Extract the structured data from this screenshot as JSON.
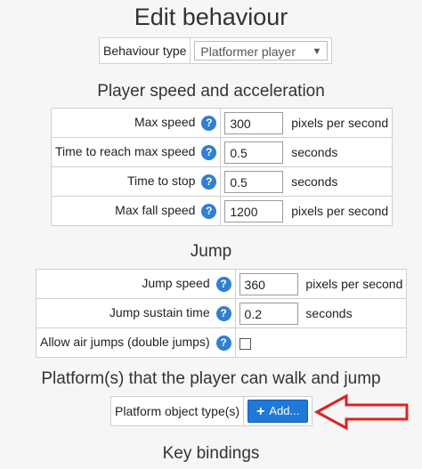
{
  "title": "Edit behaviour",
  "behaviour_type": {
    "label": "Behaviour type",
    "selected": "Platformer player"
  },
  "speed_section": {
    "heading": "Player speed and acceleration",
    "rows": [
      {
        "label": "Max speed",
        "value": "300",
        "unit": "pixels per second"
      },
      {
        "label": "Time to reach max speed",
        "value": "0.5",
        "unit": "seconds"
      },
      {
        "label": "Time to stop",
        "value": "0.5",
        "unit": "seconds"
      },
      {
        "label": "Max fall speed",
        "value": "1200",
        "unit": "pixels per second"
      }
    ]
  },
  "jump_section": {
    "heading": "Jump",
    "rows": [
      {
        "label": "Jump speed",
        "value": "360",
        "unit": "pixels per second"
      },
      {
        "label": "Jump sustain time",
        "value": "0.2",
        "unit": "seconds"
      },
      {
        "label": "Allow air jumps (double jumps)",
        "checked": false
      }
    ]
  },
  "platform_section": {
    "heading": "Platform(s) that the player can walk and jump",
    "label": "Platform object type(s)",
    "add_button": "Add..."
  },
  "keybindings_section": {
    "heading": "Key bindings"
  },
  "help_glyph": "?",
  "colors": {
    "accent": "#1f79d9",
    "help": "#2f7fd4",
    "arrow": "#e02020"
  },
  "icons": {
    "help": "help-icon",
    "plus": "plus-icon",
    "dropdown": "chevron-down-icon",
    "arrow": "red-arrow-icon"
  }
}
